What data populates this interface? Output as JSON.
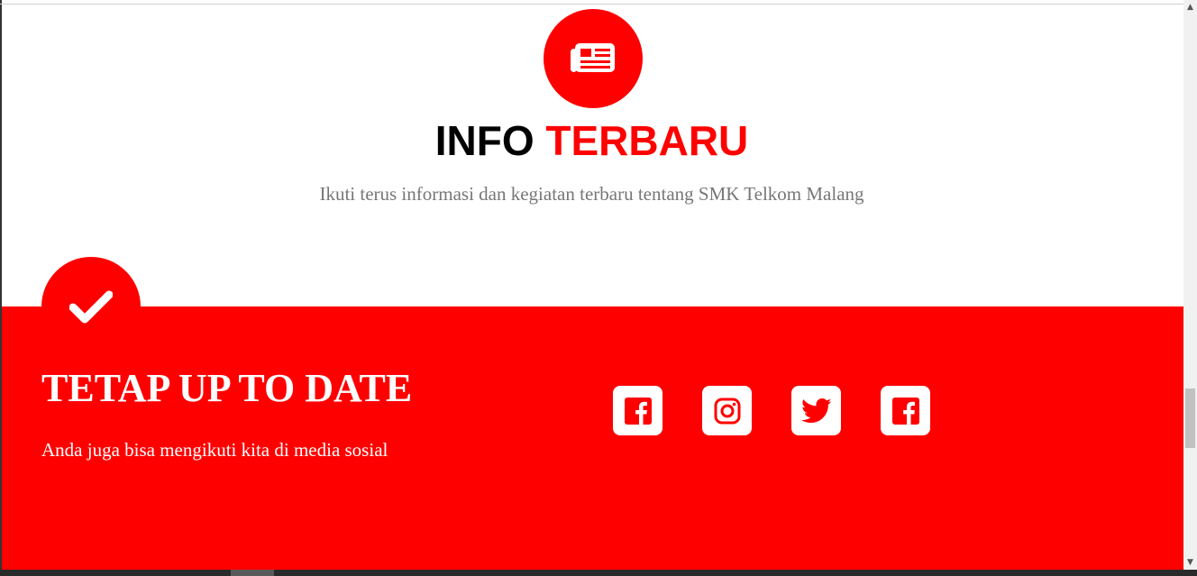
{
  "info": {
    "icon": "newspaper-icon",
    "title_black": "INFO",
    "title_red": "TERBARU",
    "subtitle": "Ikuti terus informasi dan kegiatan terbaru tentang SMK Telkom Malang"
  },
  "update": {
    "icon": "check-icon",
    "title": "TETAP UP TO DATE",
    "subtitle": "Anda juga bisa mengikuti kita di media sosial"
  },
  "social": [
    {
      "icon": "facebook-icon"
    },
    {
      "icon": "instagram-icon"
    },
    {
      "icon": "twitter-icon"
    },
    {
      "icon": "facebook-icon"
    }
  ],
  "colors": {
    "accent": "#ff0000",
    "text_dark": "#000000",
    "text_muted": "#777777",
    "white": "#ffffff"
  }
}
